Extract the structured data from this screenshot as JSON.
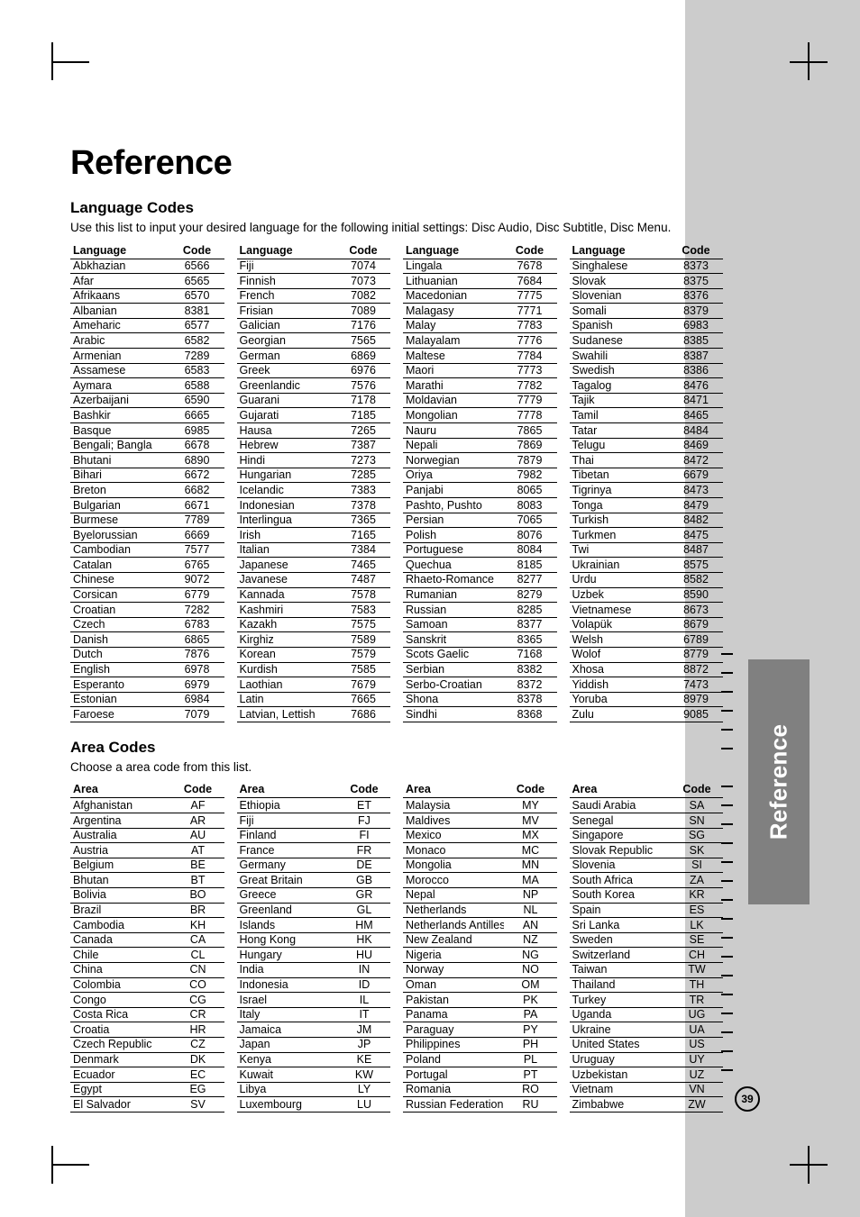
{
  "document": {
    "title": "Reference",
    "page_number": "39",
    "side_tab_label": "Reference"
  },
  "language_section": {
    "heading": "Language Codes",
    "description": "Use this list to input your desired language for the following initial settings: Disc Audio, Disc Subtitle, Disc Menu.",
    "headers": {
      "name": "Language",
      "code": "Code"
    },
    "columns": [
      [
        [
          "Abkhazian",
          "6566"
        ],
        [
          "Afar",
          "6565"
        ],
        [
          "Afrikaans",
          "6570"
        ],
        [
          "Albanian",
          "8381"
        ],
        [
          "Ameharic",
          "6577"
        ],
        [
          "Arabic",
          "6582"
        ],
        [
          "Armenian",
          "7289"
        ],
        [
          "Assamese",
          "6583"
        ],
        [
          "Aymara",
          "6588"
        ],
        [
          "Azerbaijani",
          "6590"
        ],
        [
          "Bashkir",
          "6665"
        ],
        [
          "Basque",
          "6985"
        ],
        [
          "Bengali; Bangla",
          "6678"
        ],
        [
          "Bhutani",
          "6890"
        ],
        [
          "Bihari",
          "6672"
        ],
        [
          "Breton",
          "6682"
        ],
        [
          "Bulgarian",
          "6671"
        ],
        [
          "Burmese",
          "7789"
        ],
        [
          "Byelorussian",
          "6669"
        ],
        [
          "Cambodian",
          "7577"
        ],
        [
          "Catalan",
          "6765"
        ],
        [
          "Chinese",
          "9072"
        ],
        [
          "Corsican",
          "6779"
        ],
        [
          "Croatian",
          "7282"
        ],
        [
          "Czech",
          "6783"
        ],
        [
          "Danish",
          "6865"
        ],
        [
          "Dutch",
          "7876"
        ],
        [
          "English",
          "6978"
        ],
        [
          "Esperanto",
          "6979"
        ],
        [
          "Estonian",
          "6984"
        ],
        [
          "Faroese",
          "7079"
        ]
      ],
      [
        [
          "Fiji",
          "7074"
        ],
        [
          "Finnish",
          "7073"
        ],
        [
          "French",
          "7082"
        ],
        [
          "Frisian",
          "7089"
        ],
        [
          "Galician",
          "7176"
        ],
        [
          "Georgian",
          "7565"
        ],
        [
          "German",
          "6869"
        ],
        [
          "Greek",
          "6976"
        ],
        [
          "Greenlandic",
          "7576"
        ],
        [
          "Guarani",
          "7178"
        ],
        [
          "Gujarati",
          "7185"
        ],
        [
          "Hausa",
          "7265"
        ],
        [
          "Hebrew",
          "7387"
        ],
        [
          "Hindi",
          "7273"
        ],
        [
          "Hungarian",
          "7285"
        ],
        [
          "Icelandic",
          "7383"
        ],
        [
          "Indonesian",
          "7378"
        ],
        [
          "Interlingua",
          "7365"
        ],
        [
          "Irish",
          "7165"
        ],
        [
          "Italian",
          "7384"
        ],
        [
          "Japanese",
          "7465"
        ],
        [
          "Javanese",
          "7487"
        ],
        [
          "Kannada",
          "7578"
        ],
        [
          "Kashmiri",
          "7583"
        ],
        [
          "Kazakh",
          "7575"
        ],
        [
          "Kirghiz",
          "7589"
        ],
        [
          "Korean",
          "7579"
        ],
        [
          "Kurdish",
          "7585"
        ],
        [
          "Laothian",
          "7679"
        ],
        [
          "Latin",
          "7665"
        ],
        [
          "Latvian, Lettish",
          "7686"
        ]
      ],
      [
        [
          "Lingala",
          "7678"
        ],
        [
          "Lithuanian",
          "7684"
        ],
        [
          "Macedonian",
          "7775"
        ],
        [
          "Malagasy",
          "7771"
        ],
        [
          "Malay",
          "7783"
        ],
        [
          "Malayalam",
          "7776"
        ],
        [
          "Maltese",
          "7784"
        ],
        [
          "Maori",
          "7773"
        ],
        [
          "Marathi",
          "7782"
        ],
        [
          "Moldavian",
          "7779"
        ],
        [
          "Mongolian",
          "7778"
        ],
        [
          "Nauru",
          "7865"
        ],
        [
          "Nepali",
          "7869"
        ],
        [
          "Norwegian",
          "7879"
        ],
        [
          "Oriya",
          "7982"
        ],
        [
          "Panjabi",
          "8065"
        ],
        [
          "Pashto, Pushto",
          "8083"
        ],
        [
          "Persian",
          "7065"
        ],
        [
          "Polish",
          "8076"
        ],
        [
          "Portuguese",
          "8084"
        ],
        [
          "Quechua",
          "8185"
        ],
        [
          "Rhaeto-Romance",
          "8277"
        ],
        [
          "Rumanian",
          "8279"
        ],
        [
          "Russian",
          "8285"
        ],
        [
          "Samoan",
          "8377"
        ],
        [
          "Sanskrit",
          "8365"
        ],
        [
          "Scots Gaelic",
          "7168"
        ],
        [
          "Serbian",
          "8382"
        ],
        [
          "Serbo-Croatian",
          "8372"
        ],
        [
          "Shona",
          "8378"
        ],
        [
          "Sindhi",
          "8368"
        ]
      ],
      [
        [
          "Singhalese",
          "8373"
        ],
        [
          "Slovak",
          "8375"
        ],
        [
          "Slovenian",
          "8376"
        ],
        [
          "Somali",
          "8379"
        ],
        [
          "Spanish",
          "6983"
        ],
        [
          "Sudanese",
          "8385"
        ],
        [
          "Swahili",
          "8387"
        ],
        [
          "Swedish",
          "8386"
        ],
        [
          "Tagalog",
          "8476"
        ],
        [
          "Tajik",
          "8471"
        ],
        [
          "Tamil",
          "8465"
        ],
        [
          "Tatar",
          "8484"
        ],
        [
          "Telugu",
          "8469"
        ],
        [
          "Thai",
          "8472"
        ],
        [
          "Tibetan",
          "6679"
        ],
        [
          "Tigrinya",
          "8473"
        ],
        [
          "Tonga",
          "8479"
        ],
        [
          "Turkish",
          "8482"
        ],
        [
          "Turkmen",
          "8475"
        ],
        [
          "Twi",
          "8487"
        ],
        [
          "Ukrainian",
          "8575"
        ],
        [
          "Urdu",
          "8582"
        ],
        [
          "Uzbek",
          "8590"
        ],
        [
          "Vietnamese",
          "8673"
        ],
        [
          "Volapük",
          "8679"
        ],
        [
          "Welsh",
          "6789"
        ],
        [
          "Wolof",
          "8779"
        ],
        [
          "Xhosa",
          "8872"
        ],
        [
          "Yiddish",
          "7473"
        ],
        [
          "Yoruba",
          "8979"
        ],
        [
          "Zulu",
          "9085"
        ]
      ]
    ]
  },
  "area_section": {
    "heading": "Area Codes",
    "description": "Choose a area code from this list.",
    "headers": {
      "name": "Area",
      "code": "Code"
    },
    "columns": [
      [
        [
          "Afghanistan",
          "AF"
        ],
        [
          "Argentina",
          "AR"
        ],
        [
          "Australia",
          "AU"
        ],
        [
          "Austria",
          "AT"
        ],
        [
          "Belgium",
          "BE"
        ],
        [
          "Bhutan",
          "BT"
        ],
        [
          "Bolivia",
          "BO"
        ],
        [
          "Brazil",
          "BR"
        ],
        [
          "Cambodia",
          "KH"
        ],
        [
          "Canada",
          "CA"
        ],
        [
          "Chile",
          "CL"
        ],
        [
          "China",
          "CN"
        ],
        [
          "Colombia",
          "CO"
        ],
        [
          "Congo",
          "CG"
        ],
        [
          "Costa Rica",
          "CR"
        ],
        [
          "Croatia",
          "HR"
        ],
        [
          "Czech Republic",
          "CZ"
        ],
        [
          "Denmark",
          "DK"
        ],
        [
          "Ecuador",
          "EC"
        ],
        [
          "Egypt",
          "EG"
        ],
        [
          "El Salvador",
          "SV"
        ]
      ],
      [
        [
          "Ethiopia",
          "ET"
        ],
        [
          "Fiji",
          "FJ"
        ],
        [
          "Finland",
          "FI"
        ],
        [
          "France",
          "FR"
        ],
        [
          "Germany",
          "DE"
        ],
        [
          "Great Britain",
          "GB"
        ],
        [
          "Greece",
          "GR"
        ],
        [
          "Greenland",
          "GL"
        ],
        [
          "Islands",
          "HM"
        ],
        [
          "Hong Kong",
          "HK"
        ],
        [
          "Hungary",
          "HU"
        ],
        [
          "India",
          "IN"
        ],
        [
          "Indonesia",
          "ID"
        ],
        [
          "Israel",
          "IL"
        ],
        [
          "Italy",
          "IT"
        ],
        [
          "Jamaica",
          "JM"
        ],
        [
          "Japan",
          "JP"
        ],
        [
          "Kenya",
          "KE"
        ],
        [
          "Kuwait",
          "KW"
        ],
        [
          "Libya",
          "LY"
        ],
        [
          "Luxembourg",
          "LU"
        ]
      ],
      [
        [
          "Malaysia",
          "MY"
        ],
        [
          "Maldives",
          "MV"
        ],
        [
          "Mexico",
          "MX"
        ],
        [
          "Monaco",
          "MC"
        ],
        [
          "Mongolia",
          "MN"
        ],
        [
          "Morocco",
          "MA"
        ],
        [
          "Nepal",
          "NP"
        ],
        [
          "Netherlands",
          "NL"
        ],
        [
          "Netherlands Antilles",
          "AN"
        ],
        [
          "New Zealand",
          "NZ"
        ],
        [
          "Nigeria",
          "NG"
        ],
        [
          "Norway",
          "NO"
        ],
        [
          "Oman",
          "OM"
        ],
        [
          "Pakistan",
          "PK"
        ],
        [
          "Panama",
          "PA"
        ],
        [
          "Paraguay",
          "PY"
        ],
        [
          "Philippines",
          "PH"
        ],
        [
          "Poland",
          "PL"
        ],
        [
          "Portugal",
          "PT"
        ],
        [
          "Romania",
          "RO"
        ],
        [
          "Russian Federation",
          "RU"
        ]
      ],
      [
        [
          "Saudi Arabia",
          "SA"
        ],
        [
          "Senegal",
          "SN"
        ],
        [
          "Singapore",
          "SG"
        ],
        [
          "Slovak Republic",
          "SK"
        ],
        [
          "Slovenia",
          "SI"
        ],
        [
          "South Africa",
          "ZA"
        ],
        [
          "South Korea",
          "KR"
        ],
        [
          "Spain",
          "ES"
        ],
        [
          "Sri Lanka",
          "LK"
        ],
        [
          "Sweden",
          "SE"
        ],
        [
          "Switzerland",
          "CH"
        ],
        [
          "Taiwan",
          "TW"
        ],
        [
          "Thailand",
          "TH"
        ],
        [
          "Turkey",
          "TR"
        ],
        [
          "Uganda",
          "UG"
        ],
        [
          "Ukraine",
          "UA"
        ],
        [
          "United States",
          "US"
        ],
        [
          "Uruguay",
          "UY"
        ],
        [
          "Uzbekistan",
          "UZ"
        ],
        [
          "Vietnam",
          "VN"
        ],
        [
          "Zimbabwe",
          "ZW"
        ]
      ]
    ]
  }
}
